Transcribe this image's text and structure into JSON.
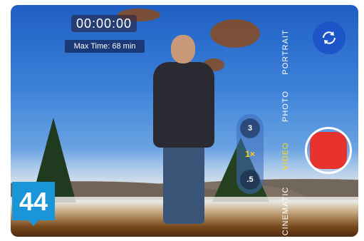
{
  "camera": {
    "timer": "00:00:00",
    "max_time": "Max Time: 68 min",
    "zoom_options": [
      {
        "label": "3",
        "active": false
      },
      {
        "label": "1×",
        "active": true
      },
      {
        "label": ".5",
        "active": false
      }
    ],
    "modes": [
      {
        "label": "PORTRAIT",
        "active": false
      },
      {
        "label": "PHOTO",
        "active": false
      },
      {
        "label": "VIDEO",
        "active": true
      },
      {
        "label": "CINEMATIC",
        "active": false
      }
    ],
    "record_color": "#e8322e",
    "accent_color": "#ffd60a"
  },
  "badge": {
    "number": "44",
    "color": "#1a96d8"
  }
}
